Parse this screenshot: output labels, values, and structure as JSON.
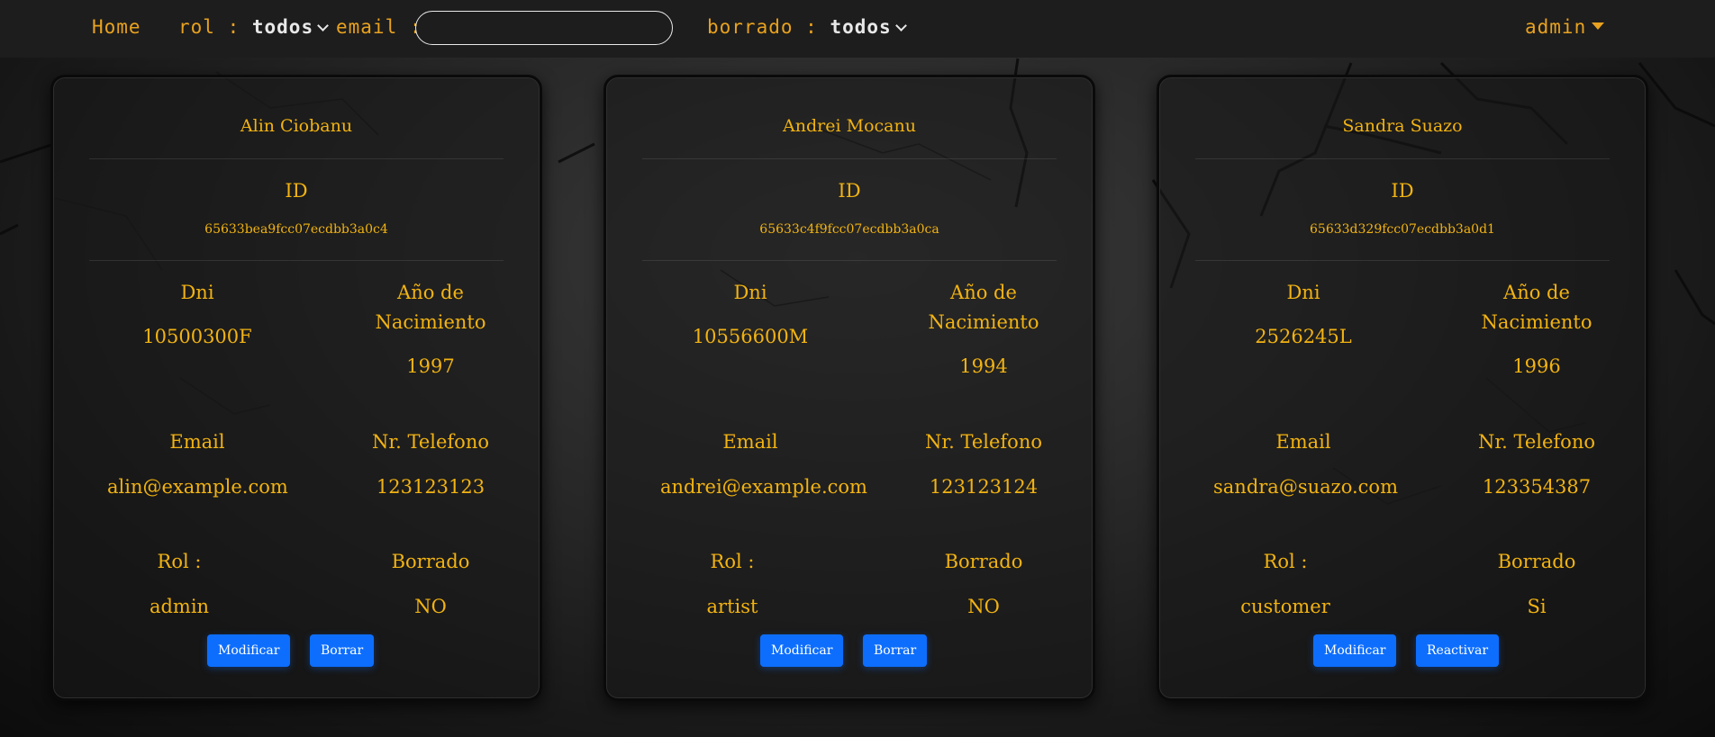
{
  "nav": {
    "home": "Home",
    "rol_label": "rol :",
    "rol_value": "todos",
    "email_label": "email :",
    "email_value": "",
    "borrado_label": "borrado :",
    "borrado_value": "todos",
    "user": "admin"
  },
  "labels": {
    "id": "ID",
    "dni": "Dni",
    "birth_line1": "Año de",
    "birth_line2": "Nacimiento",
    "email": "Email",
    "phone": "Nr. Telefono",
    "rol": "Rol :",
    "borrado": "Borrado"
  },
  "users": [
    {
      "name": "Alin Ciobanu",
      "id": "65633bea9fcc07ecdbb3a0c4",
      "dni": "10500300F",
      "birth_year": "1997",
      "email": "alin@example.com",
      "phone": "123123123",
      "rol": "admin",
      "borrado": "NO",
      "btn_modify": "Modificar",
      "btn_action": "Borrar"
    },
    {
      "name": "Andrei Mocanu",
      "id": "65633c4f9fcc07ecdbb3a0ca",
      "dni": "10556600M",
      "birth_year": "1994",
      "email": "andrei@example.com",
      "phone": "123123124",
      "rol": "artist",
      "borrado": "NO",
      "btn_modify": "Modificar",
      "btn_action": "Borrar"
    },
    {
      "name": "Sandra Suazo",
      "id": "65633d329fcc07ecdbb3a0d1",
      "dni": "2526245L",
      "birth_year": "1996",
      "email": "sandra@suazo.com",
      "phone": "123354387",
      "rol": "customer",
      "borrado": "Si",
      "btn_modify": "Modificar",
      "btn_action": "Reactivar"
    }
  ],
  "colors": {
    "accent": "#f2b312",
    "nav_text": "#e8a21f",
    "button": "#0d6efd",
    "navbar_bg": "#1d1d1d"
  }
}
